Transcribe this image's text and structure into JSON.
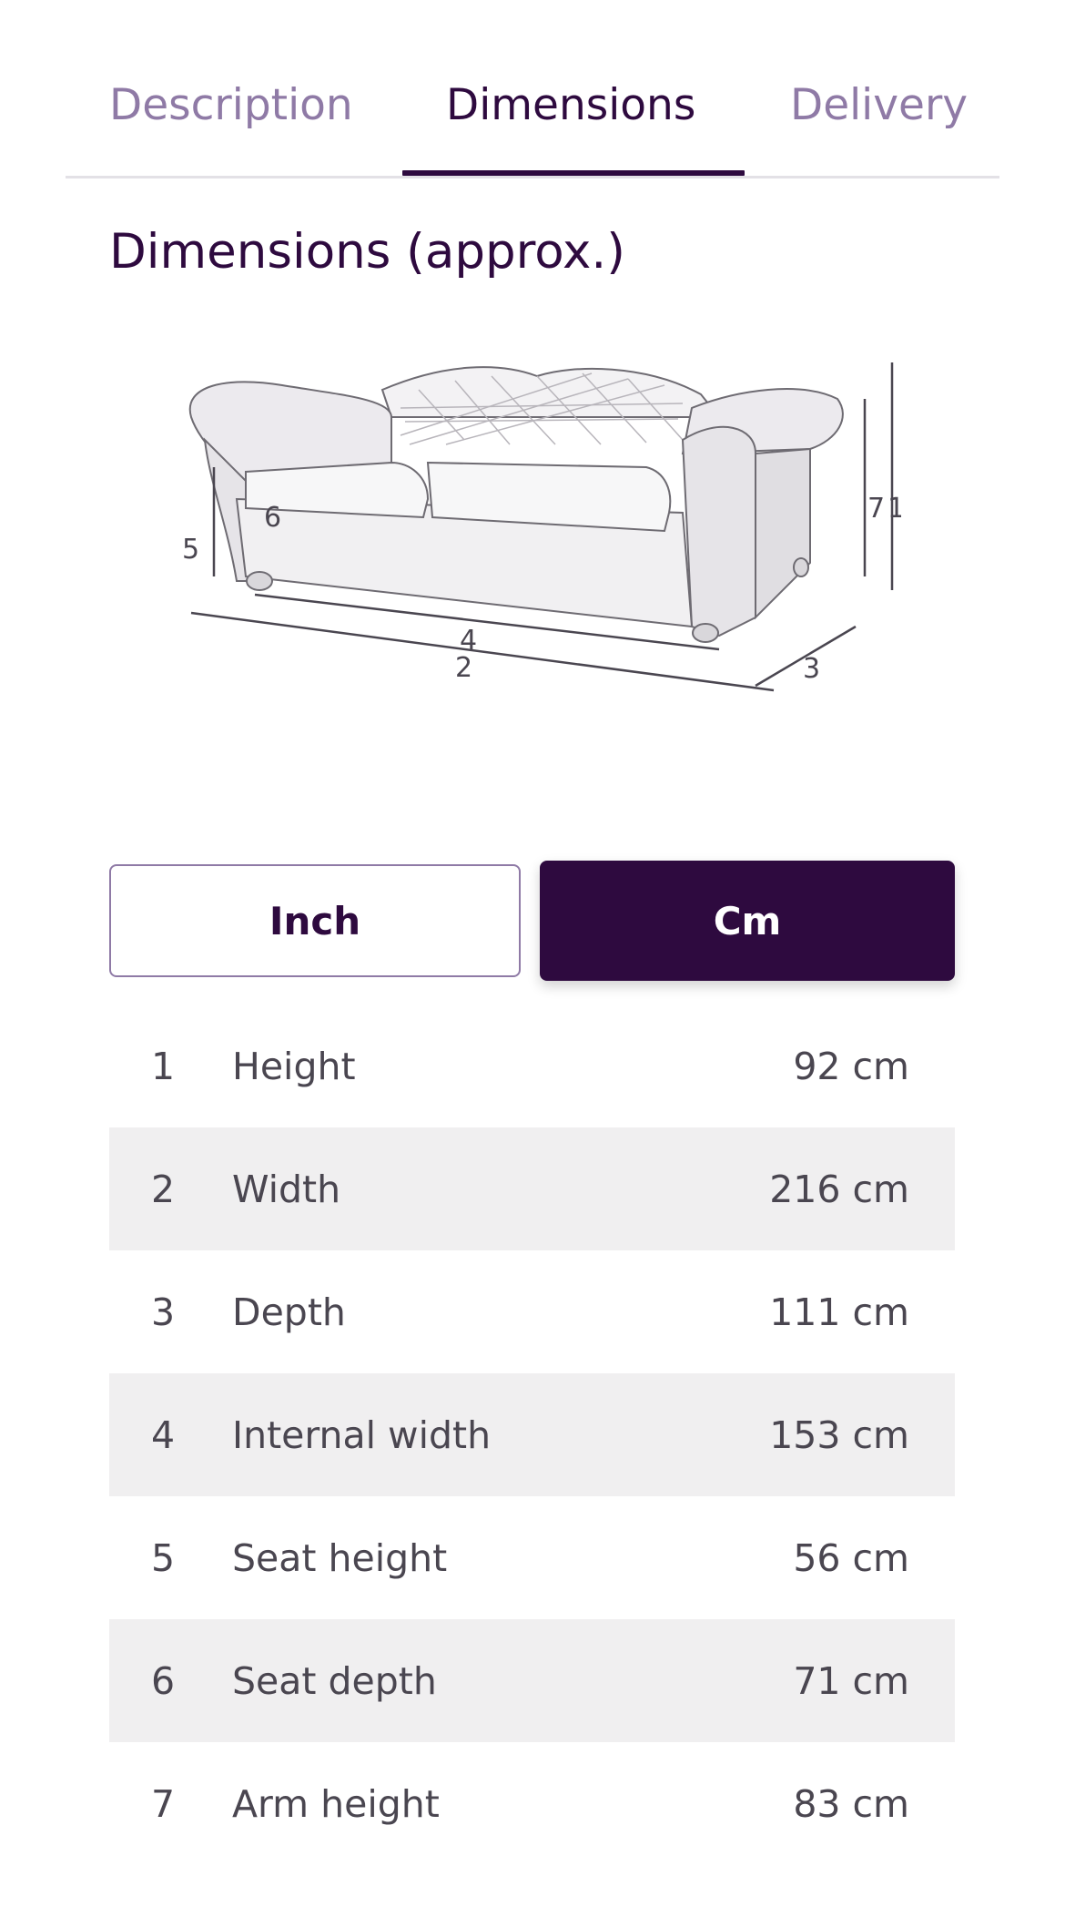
{
  "tabs": [
    {
      "label": "Description",
      "active": false
    },
    {
      "label": "Dimensions",
      "active": true
    },
    {
      "label": "Delivery",
      "active": false
    }
  ],
  "section_title": "Dimensions (approx.)",
  "diagram": {
    "icon": "sofa-dimensions-illustration",
    "markers": [
      "1",
      "2",
      "3",
      "4",
      "5",
      "6",
      "7"
    ]
  },
  "unit_toggle": {
    "options": [
      "Inch",
      "Cm"
    ],
    "selected": "Cm"
  },
  "dimensions": [
    {
      "num": "1",
      "label": "Height",
      "value": "92 cm"
    },
    {
      "num": "2",
      "label": "Width",
      "value": "216 cm"
    },
    {
      "num": "3",
      "label": "Depth",
      "value": "111 cm"
    },
    {
      "num": "4",
      "label": "Internal width",
      "value": "153 cm"
    },
    {
      "num": "5",
      "label": "Seat height",
      "value": "56 cm"
    },
    {
      "num": "6",
      "label": "Seat depth",
      "value": "71 cm"
    },
    {
      "num": "7",
      "label": "Arm height",
      "value": "83 cm"
    }
  ],
  "colors": {
    "brand": "#2e0a3f",
    "inactive_tab": "#8f7aa6",
    "row_alt": "#f0eff0"
  }
}
